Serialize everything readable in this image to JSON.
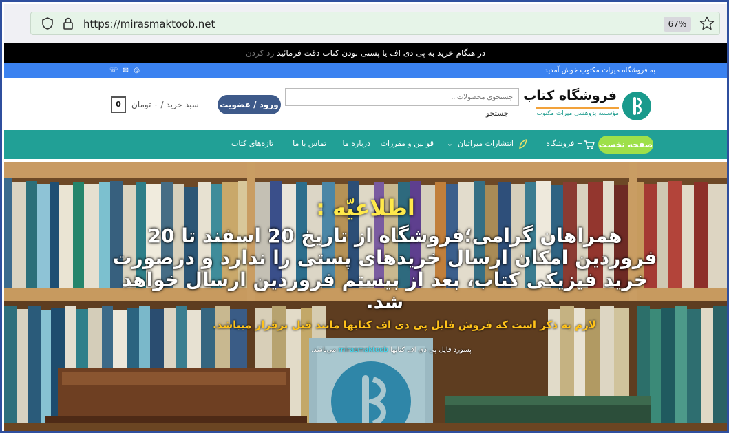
{
  "browser": {
    "url": "https://mirasmaktoob.net",
    "zoom": "67%"
  },
  "notice_bar": {
    "text": "در هنگام خرید به پی دی اف یا پستی بودن کتاب دقت فرمائید",
    "dismiss": "رد کردن"
  },
  "top_bar": {
    "welcome": "به فروشگاه میراث مکتوب خوش آمدید",
    "contacts": "☏ ✉ ◎"
  },
  "header": {
    "logo_title": "فروشگاه کتاب",
    "logo_subtitle": "مؤسسه پژوهشی میراث مکتوب",
    "search_placeholder": "جستجوی محصولات...",
    "search_button": "جستجو",
    "login_button": "ورود / عضویت",
    "cart_label": "سبد خرید / ۰ تومان",
    "cart_count": "0"
  },
  "nav": {
    "home": "صفحه نخست",
    "items": [
      "≡ فروشگاه",
      "انتشارات میراثیان",
      "قوانین و مقررات",
      "درباره ما",
      "تماس با ما",
      "تازه‌های کتاب"
    ]
  },
  "hero": {
    "title": "اطلاعیّه :",
    "body": "همراهان گرامی؛فروشگاه از تاریخ 20 اسفند تا 20 فروردین امکان ارسال خریدهای پستی را ندارد و درصورت خرید فیزیکی کتاب، بعد از بیستم فروردین ارسال خواهد شد.",
    "note": "لازم به ذکر است که فروش فایل پی دی اف کتابها مانند قبل برقرار میباشد.",
    "small_before": "پسورد فایل پی دی اف کتابها",
    "small_brand": "mirasmaktoob",
    "small_after": "می‌باشد."
  },
  "colors": {
    "topbar": "#3b82f0",
    "nav": "#21a096",
    "home_button": "#9ee04a",
    "login_button": "#3e5a8a",
    "hero_title": "#ffe94a",
    "hero_note": "#ffc21a"
  }
}
